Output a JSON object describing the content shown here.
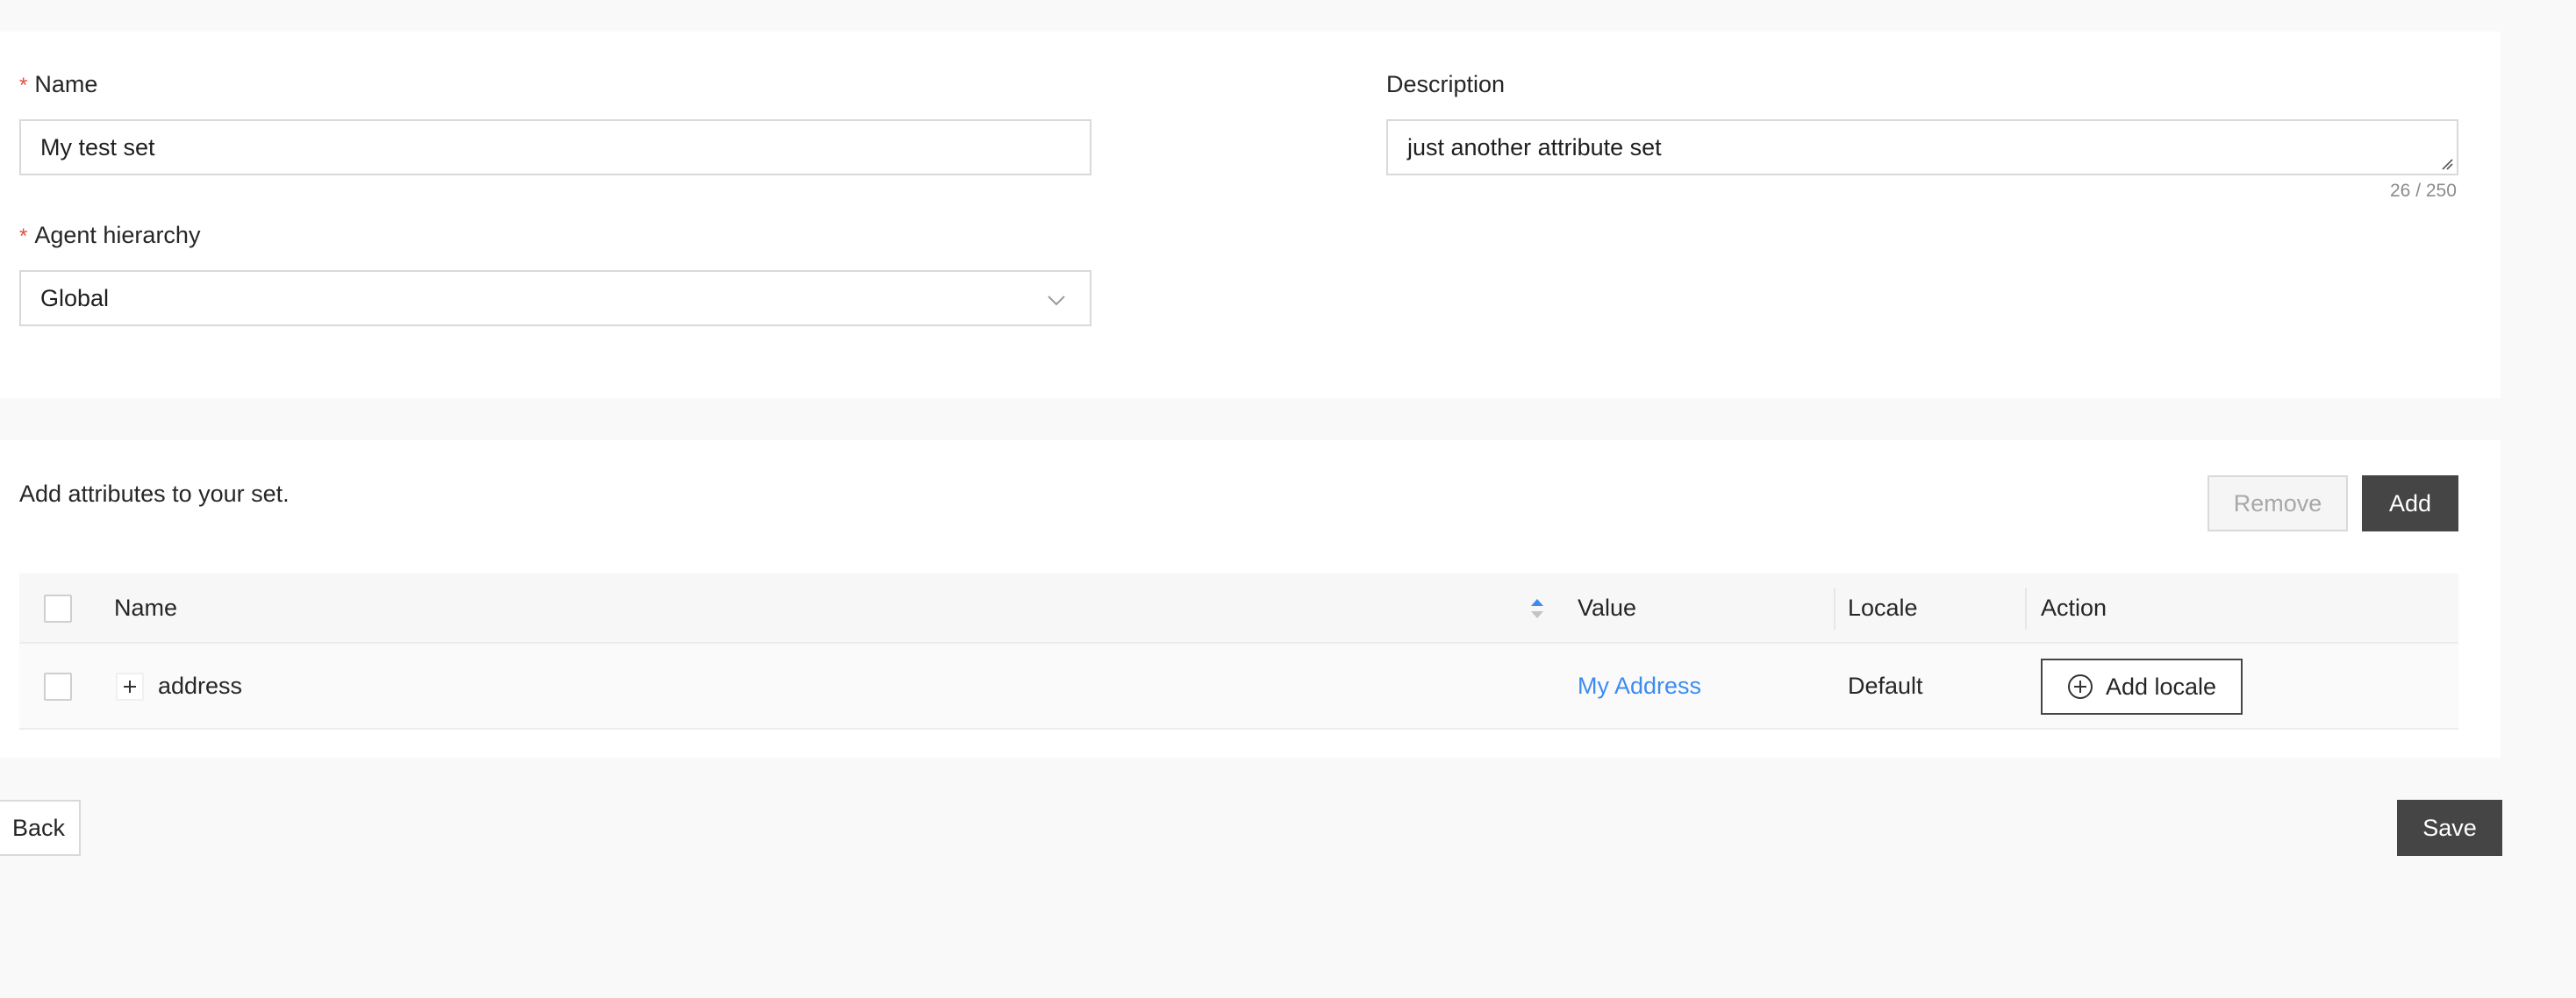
{
  "form": {
    "name": {
      "label": "Name",
      "required": "*",
      "value": "My test set"
    },
    "description": {
      "label": "Description",
      "value": "just another attribute set",
      "counter": "26 / 250"
    },
    "agent_hierarchy": {
      "label": "Agent hierarchy",
      "required": "*",
      "selected": "Global"
    }
  },
  "attributes": {
    "title": "Add attributes to your set.",
    "remove_label": "Remove",
    "add_label": "Add",
    "columns": [
      "Name",
      "Value",
      "Locale",
      "Action"
    ],
    "rows": [
      {
        "name": "address",
        "value": "My Address",
        "locale": "Default",
        "action": "Add locale"
      }
    ]
  },
  "footer": {
    "back_label": "Back",
    "save_label": "Save"
  },
  "colors": {
    "primary_button": "#454545",
    "link": "#3d8bf0",
    "required": "#e34d3c",
    "sort_active": "#3d8bf0"
  },
  "icons": {
    "expand": "plus-icon",
    "add_locale": "plus-circle-icon",
    "select_arrow": "chevron-down-icon",
    "sort": "sort-icon"
  }
}
